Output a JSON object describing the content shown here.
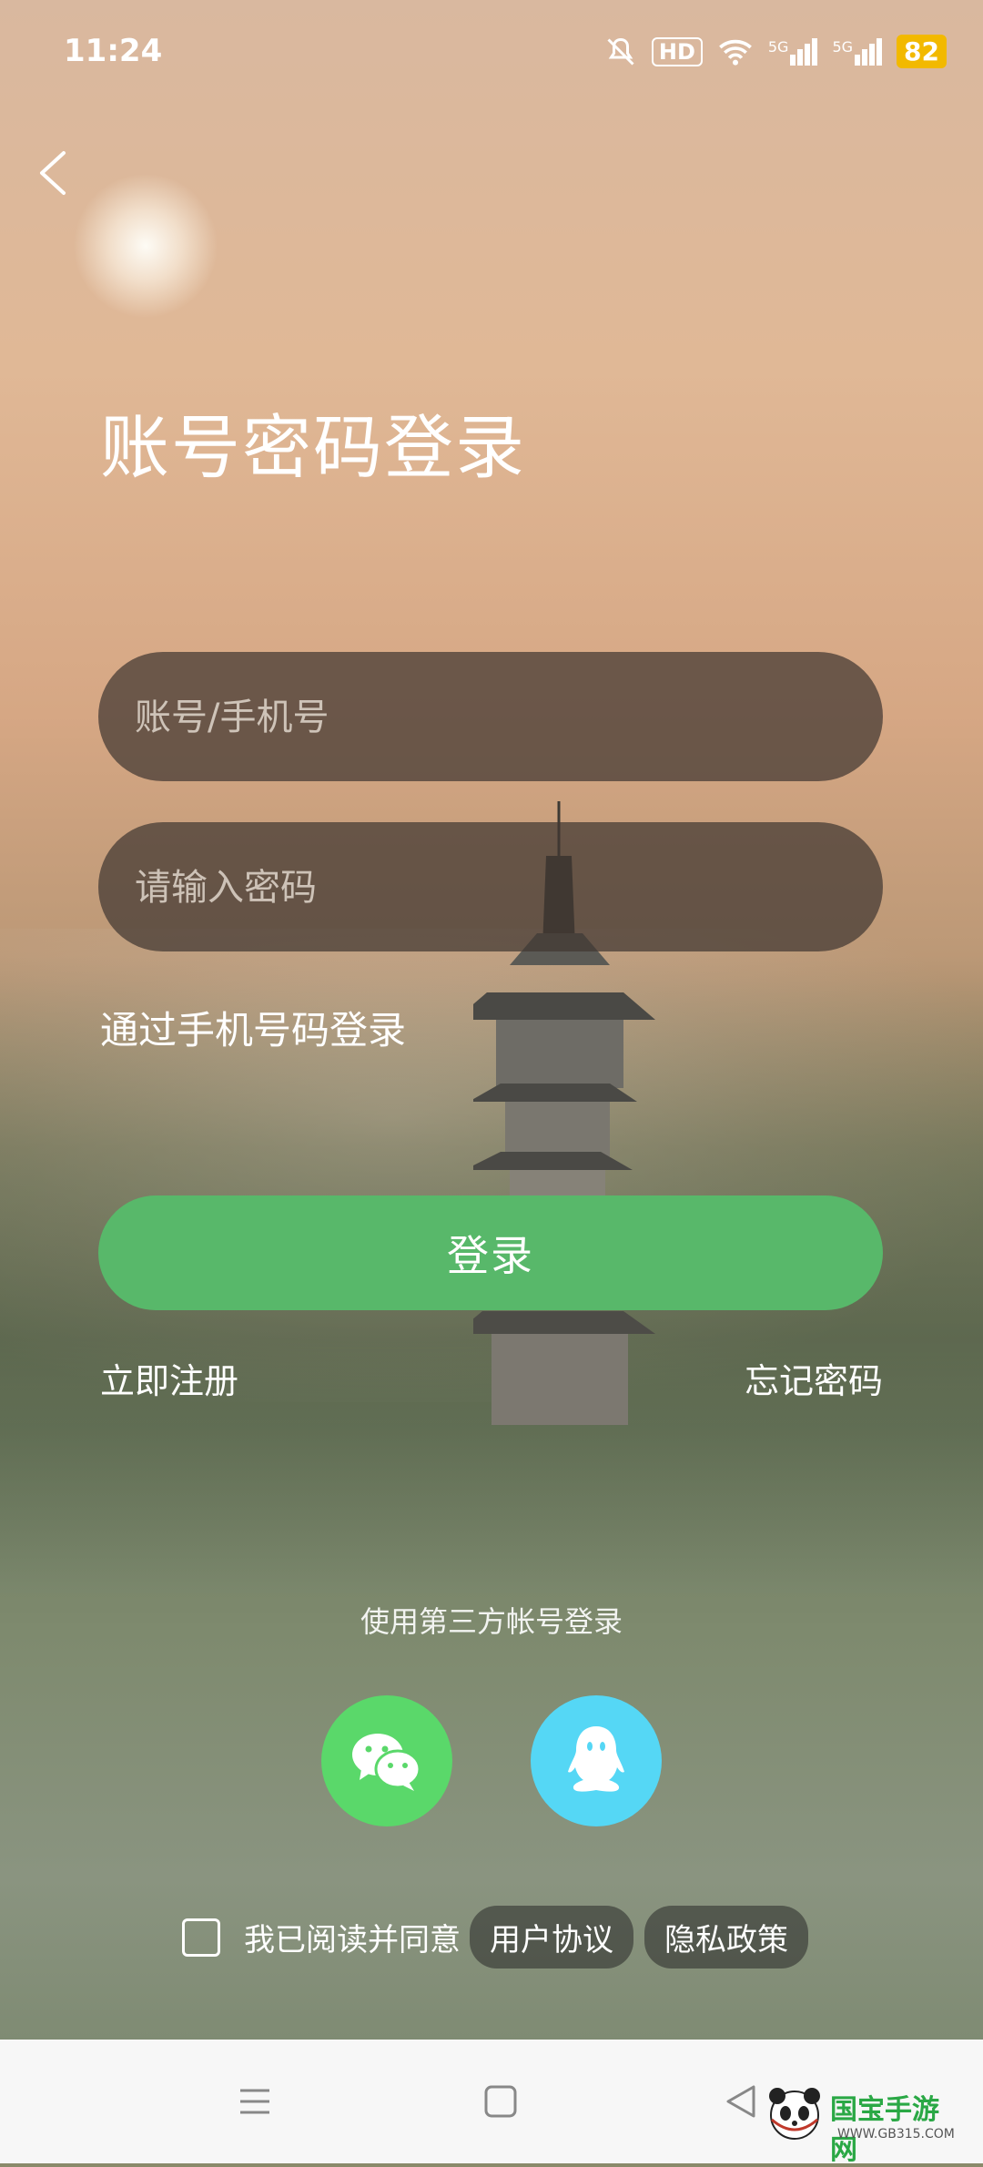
{
  "status_bar": {
    "time": "11:24",
    "battery": "82",
    "hd": "HD",
    "net_left": "5G",
    "net_right": "5G"
  },
  "header": {
    "title": "账号密码登录"
  },
  "form": {
    "account_placeholder": "账号/手机号",
    "password_placeholder": "请输入密码",
    "phone_login_link": "通过手机号码登录",
    "login_button": "登录",
    "register_link": "立即注册",
    "forgot_link": "忘记密码"
  },
  "third_party": {
    "label": "使用第三方帐号登录",
    "icons": [
      "wechat-icon",
      "qq-icon"
    ]
  },
  "agreement": {
    "text": "我已阅读并同意",
    "user_agreement": "用户协议",
    "privacy_policy": "隐私政策"
  },
  "watermark": {
    "name": "国宝手游网",
    "url": "WWW.GB315.COM"
  },
  "colors": {
    "login_button": "#58b86a",
    "wechat": "#5ad86a",
    "qq": "#55d7f5",
    "battery": "#f2b900"
  }
}
